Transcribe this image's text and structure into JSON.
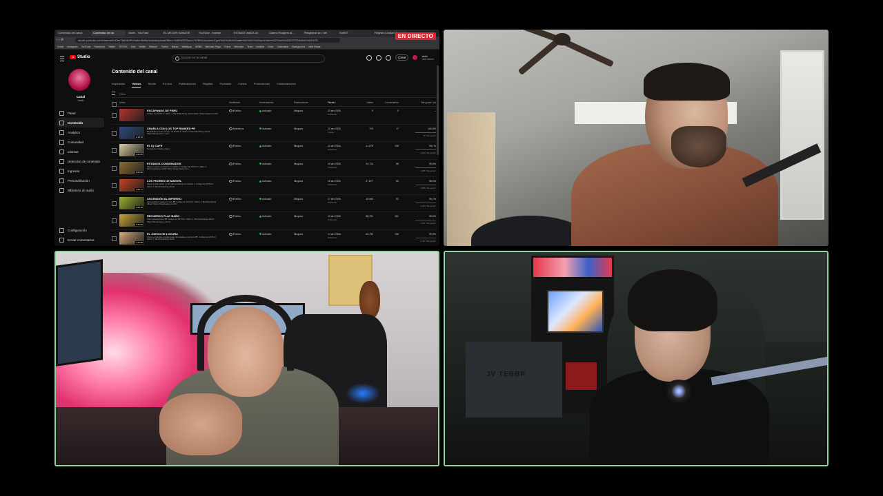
{
  "browser": {
    "tabs": [
      "Contenido del canal",
      "Contenido del ca",
      "Vadín - YouTube",
      "EL MEJOR SUMATIE",
      "YouTube - maneje",
      "ESTADO Vadí24-AT",
      "Calend Rodgers al…",
      "Resgistrar sin / del",
      "SorBIT",
      "Registro Unidad de m"
    ],
    "active_tab": 1,
    "url": "studio.youtube.com/channel/UCbeT8dJ4hfPxSs6nnSdNs/videos/upload?filter=%5B%5D&sort=%7B%22columnType%22%3A%22date%22%2C%22sortOrder%22%3A%22DESCENDING%22%7D",
    "bookmarks": [
      "Gmail",
      "Instagram",
      "YouTube",
      "Facebook",
      "Twitter",
      "TIKTOK",
      "Kick",
      "Netflix",
      "Disney+",
      "Twitch",
      "Marca",
      "Wallapop",
      "ARBA",
      "Mercado Pago",
      "Prime",
      "Mercado",
      "Tesla",
      "InfoBae",
      "Drive",
      "Calendario",
      "Background",
      "Web Radar"
    ]
  },
  "live_badge": "EN DIRECTO",
  "studio": {
    "logo": "Studio",
    "search_placeholder": "Buscar en tu canal",
    "create_label": "Crear",
    "account_name": "Vadín",
    "account_sub": "Vadí Admin",
    "channel_label": "Canal",
    "channel_sub": "Vadín",
    "nav": [
      {
        "label": "Panel",
        "icon": "dashboard-icon"
      },
      {
        "label": "Contenido",
        "icon": "content-icon",
        "active": true
      },
      {
        "label": "Analytics",
        "icon": "analytics-icon"
      },
      {
        "label": "Comunidad",
        "icon": "community-icon"
      },
      {
        "label": "Idiomas",
        "icon": "languages-icon"
      },
      {
        "label": "Detección de contenido",
        "icon": "detection-icon"
      },
      {
        "label": "Ingresos",
        "icon": "earn-icon"
      },
      {
        "label": "Personalización",
        "icon": "customization-icon"
      },
      {
        "label": "Biblioteca de audio",
        "icon": "audio-library-icon"
      }
    ],
    "nav_bottom": [
      {
        "label": "Configuración",
        "icon": "settings-icon"
      },
      {
        "label": "Enviar comentarios",
        "icon": "feedback-icon"
      }
    ],
    "page_title": "Contenido del canal",
    "content_tabs": [
      "Inspiración",
      "Vídeos",
      "Shorts",
      "En vivo",
      "Publicaciones",
      "Playlists",
      "Podcasts",
      "Cursos",
      "Promociones",
      "Colaboraciones"
    ],
    "active_content_tab": 1,
    "filter_label": "Filtro",
    "columns": {
      "video": "Vídeo",
      "visibility": "Visibilidad",
      "restrictions_monet": "Monetización",
      "restrictions": "Restricciones",
      "date": "Fecha ↓",
      "views": "Vistas",
      "comments": "Comentarios",
      "likes": "\"Me gusta\" (vs"
    },
    "videos": [
      {
        "title": "ESCAPANDO DE PERÚ",
        "desc": "Código de RVTA-F: Vadín ✔ Merchandising oficial Vadín (Shopmaster.com/V)",
        "duration": "",
        "thumb": "#b8322a",
        "visibility": "Público",
        "monetization": "Activado",
        "restrictions": "Ninguna",
        "date": "23 abr 2026",
        "status": "Publicado",
        "views": "0",
        "comments": "0",
        "likes": "–",
        "like_votes": ""
      },
      {
        "title": "CHARLA CON LOS TOP RANKED PE",
        "desc": "Regístrate con fa: Código de RVTA-F: Vadín ✔ Merchandising oficial: https://shopmaster.com/...",
        "duration": "1:15:12",
        "thumb": "#2b4a7c",
        "visibility": "Miembros",
        "monetization": "Activado",
        "restrictions": "Ninguna",
        "date": "22 abr 2026",
        "status": "Subido",
        "views": "703",
        "comments": "17",
        "likes": "100,0%",
        "like_votes": "66 \"Me gusta\""
      },
      {
        "title": "EL IQ CAFE",
        "desc": "Pendiente: Añade vídeos",
        "duration": "2:22:05",
        "thumb": "#d9c9a0",
        "visibility": "Público",
        "monetization": "Activado",
        "restrictions": "Ninguna",
        "date": "22 abr 2026",
        "status": "Publicado",
        "views": "24,578",
        "comments": "128",
        "likes": "99,1%",
        "like_votes": "2,223 \"Me gusta\""
      },
      {
        "title": "ESTAMOS CONDENADOS",
        "desc": "Sigue nuestro en directo en twitch ✔ Código de RVTA-F: Vadín ✔ Merchandising oficial: https://shopmaster.com...",
        "duration": "8:25:06",
        "thumb": "#8d6b2f",
        "visibility": "Público",
        "monetization": "Activado",
        "restrictions": "Ninguna",
        "date": "19 abr 2026",
        "status": "Publicado",
        "views": "24,711",
        "comments": "88",
        "likes": "99,0%",
        "like_votes": "1,695 \"Me gusta\""
      },
      {
        "title": "LOS PEORES DE MARVEL",
        "desc": "Sigue a este Vadín y LOS 4th (el directo en twitch) ✔ Código de RVTA-F: Vadín ✔ Merchandising oficial",
        "duration": "1:59:17",
        "thumb": "#c7411f",
        "visibility": "Público",
        "monetization": "Activado",
        "restrictions": "Ninguna",
        "date": "18 abr 2026",
        "status": "Publicado",
        "views": "27,877",
        "comments": "82",
        "likes": "98,6%",
        "like_votes": "2,895 \"Me gusta\""
      },
      {
        "title": "ASCENSIÓN AL INFIERNO",
        "desc": "Acompaña mi juego en vivo 🎮 Código de RVTA-F: Vadín ✔ Merchandising oficial: https://shopmaster.com/V...",
        "duration": "2:50:40",
        "thumb": "#9ab22c",
        "visibility": "Público",
        "monetization": "Activado",
        "restrictions": "Ninguna",
        "date": "17 abr 2026",
        "status": "Publicado",
        "views": "18,963",
        "comments": "91",
        "likes": "99,7%",
        "like_votes": "2,204 \"Me gusta\""
      },
      {
        "title": "RECUERDO PLAY BAÑO",
        "desc": "Solo subscriptores 🎮 Código de RVTA-F: Vadín ✔ Merchandising oficial: https://shopmaster.com/V...",
        "duration": "5:30:09",
        "thumb": "#c9a534",
        "visibility": "Público",
        "monetization": "Activado",
        "restrictions": "Ninguna",
        "date": "15 abr 2026",
        "status": "Publicado",
        "views": "38,751",
        "comments": "151",
        "likes": "99,6%",
        "like_votes": "3,151 \"Me gusta\""
      },
      {
        "title": "EL JUEGO DE LOCURA",
        "desc": "Ahora a meterse a todas esas novedades en directo 🎮 Código de RVTA-F: Vadín ✔ Merchandising oficial",
        "duration": "1:26:08",
        "thumb": "#d5a874",
        "visibility": "Público",
        "monetization": "Activado",
        "restrictions": "Ninguna",
        "date": "14 abr 2026",
        "status": "Publicado",
        "views": "42,753",
        "comments": "136",
        "likes": "99,5%",
        "like_votes": "2,797 \"Me gusta\""
      }
    ]
  },
  "cameras": {
    "top_right": "webcam-streamer-ceiling-fan",
    "bottom_left": "webcam-streamer-pink-lights",
    "bottom_right": "webcam-streamer-arcade",
    "bottom_right_cabinet_text": "JV  TEBBR",
    "active_border_color": "#8fd6a3"
  }
}
